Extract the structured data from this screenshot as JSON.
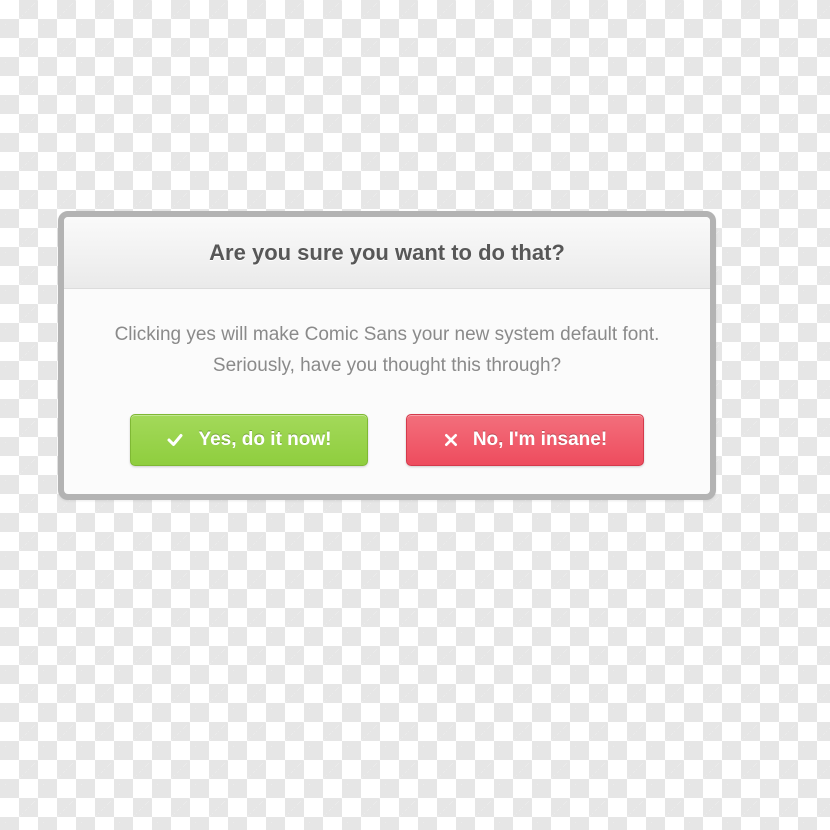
{
  "dialog": {
    "title": "Are you sure you want to do that?",
    "message": "Clicking yes will make Comic Sans your new system default font. Seriously, have you thought this through?",
    "buttons": {
      "yes": {
        "label": "Yes, do it now!"
      },
      "no": {
        "label": "No, I'm insane!"
      }
    }
  },
  "colors": {
    "yes": "#8fce3e",
    "no": "#ee4c5e"
  }
}
